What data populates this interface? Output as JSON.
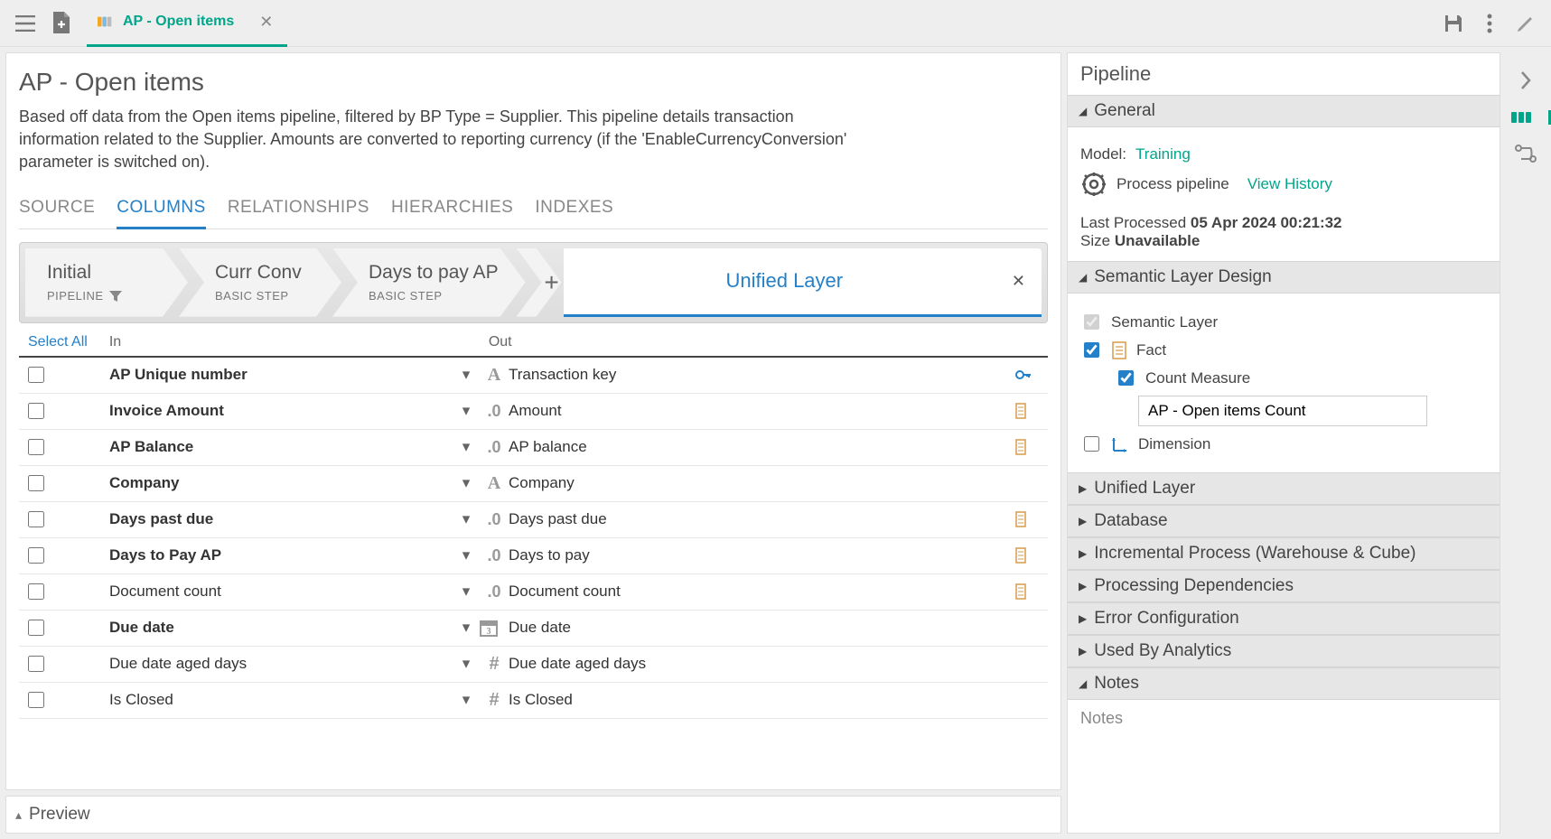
{
  "topbar": {
    "tab_title": "AP - Open items"
  },
  "page": {
    "title": "AP - Open items",
    "description": "Based off data from the Open items pipeline, filtered by BP Type = Supplier.  This pipeline details transaction information related to the Supplier.  Amounts are converted to reporting currency (if the 'EnableCurrencyConversion' parameter is switched on)."
  },
  "subtabs": [
    "SOURCE",
    "COLUMNS",
    "RELATIONSHIPS",
    "HIERARCHIES",
    "INDEXES"
  ],
  "subtab_active": "COLUMNS",
  "steps": [
    {
      "title": "Initial",
      "sub": "PIPELINE",
      "filter": true
    },
    {
      "title": "Curr Conv",
      "sub": "BASIC STEP",
      "filter": false
    },
    {
      "title": "Days to pay AP",
      "sub": "BASIC STEP",
      "filter": false
    }
  ],
  "step_final": "Unified Layer",
  "cols_head": {
    "select_all": "Select All",
    "in": "In",
    "out": "Out"
  },
  "columns": [
    {
      "in": "AP Unique number",
      "bold": true,
      "type": "A",
      "out": "Transaction key",
      "badge": "key"
    },
    {
      "in": "Invoice Amount",
      "bold": true,
      "type": ".0",
      "out": "Amount",
      "badge": "measure"
    },
    {
      "in": "AP Balance",
      "bold": true,
      "type": ".0",
      "out": "AP balance",
      "badge": "measure"
    },
    {
      "in": "Company",
      "bold": true,
      "type": "A",
      "out": "Company",
      "badge": ""
    },
    {
      "in": "Days past due",
      "bold": true,
      "type": ".0",
      "out": "Days past due",
      "badge": "measure"
    },
    {
      "in": "Days to Pay AP",
      "bold": true,
      "type": ".0",
      "out": "Days to pay",
      "badge": "measure"
    },
    {
      "in": "Document count",
      "bold": false,
      "type": ".0",
      "out": "Document count",
      "badge": "measure"
    },
    {
      "in": "Due date",
      "bold": true,
      "type": "date",
      "out": "Due date",
      "badge": ""
    },
    {
      "in": "Due date aged days",
      "bold": false,
      "type": "#",
      "out": "Due date aged days",
      "badge": ""
    },
    {
      "in": "Is Closed",
      "bold": false,
      "type": "#",
      "out": "Is Closed",
      "badge": ""
    }
  ],
  "preview": {
    "label": "Preview"
  },
  "pipeline_panel": {
    "title": "Pipeline",
    "general_label": "General",
    "model_label": "Model:",
    "model_value": "Training",
    "process_label": "Process pipeline",
    "view_history": "View History",
    "last_processed_label": "Last Processed",
    "last_processed_value": "05 Apr 2024 00:21:32",
    "size_label": "Size",
    "size_value": "Unavailable",
    "sem_design_label": "Semantic Layer Design",
    "semantic_layer": "Semantic Layer",
    "fact": "Fact",
    "count_measure": "Count Measure",
    "count_measure_value": "AP - Open items Count",
    "dimension": "Dimension",
    "sections": [
      "Unified Layer",
      "Database",
      "Incremental Process (Warehouse & Cube)",
      "Processing Dependencies",
      "Error Configuration",
      "Used By Analytics"
    ],
    "notes_label": "Notes",
    "notes_placeholder": "Notes"
  }
}
